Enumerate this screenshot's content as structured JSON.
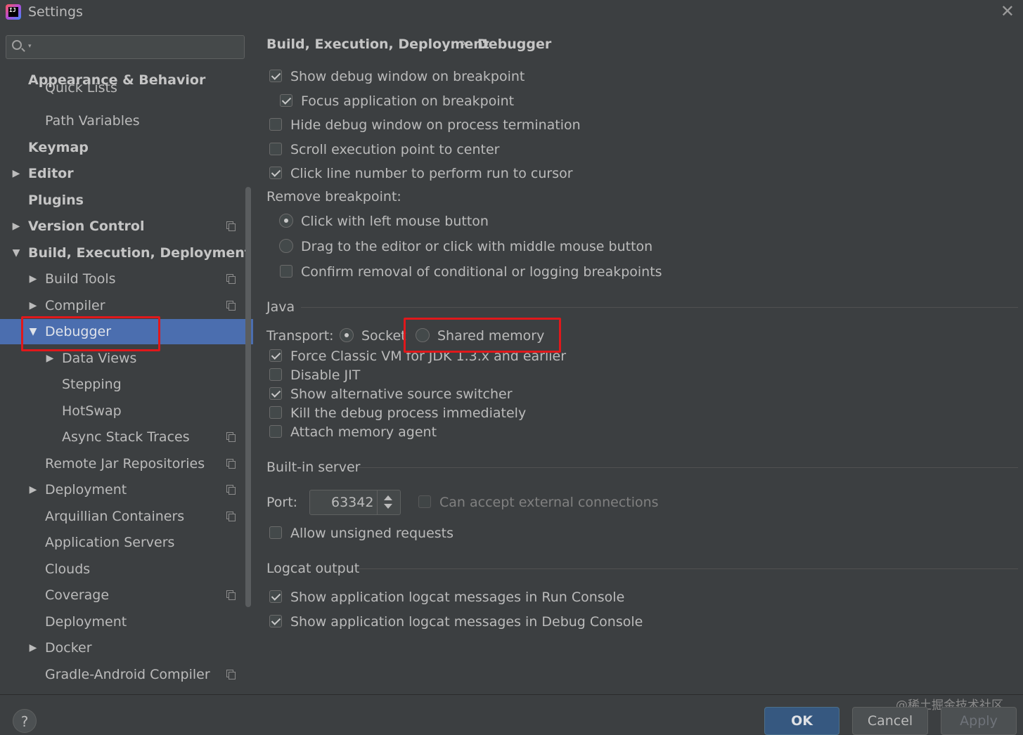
{
  "window": {
    "title": "Settings",
    "logo_text": "IJ"
  },
  "search": {
    "placeholder": ""
  },
  "sidebar": {
    "items": [
      {
        "label": "Appearance & Behavior"
      },
      {
        "label": "Quick Lists"
      },
      {
        "label": "Path Variables"
      },
      {
        "label": "Keymap"
      },
      {
        "label": "Editor"
      },
      {
        "label": "Plugins"
      },
      {
        "label": "Version Control"
      },
      {
        "label": "Build, Execution, Deployment"
      },
      {
        "label": "Build Tools"
      },
      {
        "label": "Compiler"
      },
      {
        "label": "Debugger"
      },
      {
        "label": "Data Views"
      },
      {
        "label": "Stepping"
      },
      {
        "label": "HotSwap"
      },
      {
        "label": "Async Stack Traces"
      },
      {
        "label": "Remote Jar Repositories"
      },
      {
        "label": "Deployment"
      },
      {
        "label": "Arquillian Containers"
      },
      {
        "label": "Application Servers"
      },
      {
        "label": "Clouds"
      },
      {
        "label": "Coverage"
      },
      {
        "label": "Deployment"
      },
      {
        "label": "Docker"
      },
      {
        "label": "Gradle-Android Compiler"
      }
    ],
    "selected": "Debugger"
  },
  "breadcrumb": {
    "parent": "Build, Execution, Deployment",
    "separator": "›",
    "current": "Debugger"
  },
  "options": {
    "show_debug_window": {
      "label": "Show debug window on breakpoint",
      "checked": true
    },
    "focus_app": {
      "label": "Focus application on breakpoint",
      "checked": true
    },
    "hide_debug_window": {
      "label": "Hide debug window on process termination",
      "checked": false
    },
    "scroll_exec": {
      "label": "Scroll execution point to center",
      "checked": false
    },
    "click_line": {
      "label": "Click line number to perform run to cursor",
      "checked": true
    },
    "remove_bp_title": "Remove breakpoint:",
    "remove_left": {
      "label": "Click with left mouse button",
      "selected": true
    },
    "remove_drag": {
      "label": "Drag to the editor or click with middle mouse button",
      "selected": false
    },
    "confirm_removal": {
      "label": "Confirm removal of conditional or logging breakpoints",
      "checked": false
    }
  },
  "java": {
    "title": "Java",
    "transport_label": "Transport:",
    "socket": {
      "label": "Socket",
      "selected": true
    },
    "shared_memory": {
      "label": "Shared memory",
      "selected": false
    },
    "force_classic": {
      "label": "Force Classic VM for JDK 1.3.x and earlier",
      "checked": true
    },
    "disable_jit": {
      "label": "Disable JIT",
      "checked": false
    },
    "alt_source": {
      "label": "Show alternative source switcher",
      "checked": true
    },
    "kill_debug": {
      "label": "Kill the debug process immediately",
      "checked": false
    },
    "memory_agent": {
      "label": "Attach memory agent",
      "checked": false
    }
  },
  "server": {
    "title": "Built-in server",
    "port_label": "Port:",
    "port_value": "63342",
    "external": {
      "label": "Can accept external connections",
      "checked": false
    },
    "unsigned": {
      "label": "Allow unsigned requests",
      "checked": false
    }
  },
  "logcat": {
    "title": "Logcat output",
    "run_console": {
      "label": "Show application logcat messages in Run Console",
      "checked": true
    },
    "debug_console": {
      "label": "Show application logcat messages in Debug Console",
      "checked": true
    }
  },
  "footer": {
    "help": "?",
    "ok": "OK",
    "cancel": "Cancel",
    "apply": "Apply",
    "watermark": "@稀土掘金技术社区"
  },
  "colors": {
    "background": "#3c3f41",
    "selection": "#4b6eaf",
    "highlight_box": "#e0181b",
    "ok_button": "#365880"
  }
}
